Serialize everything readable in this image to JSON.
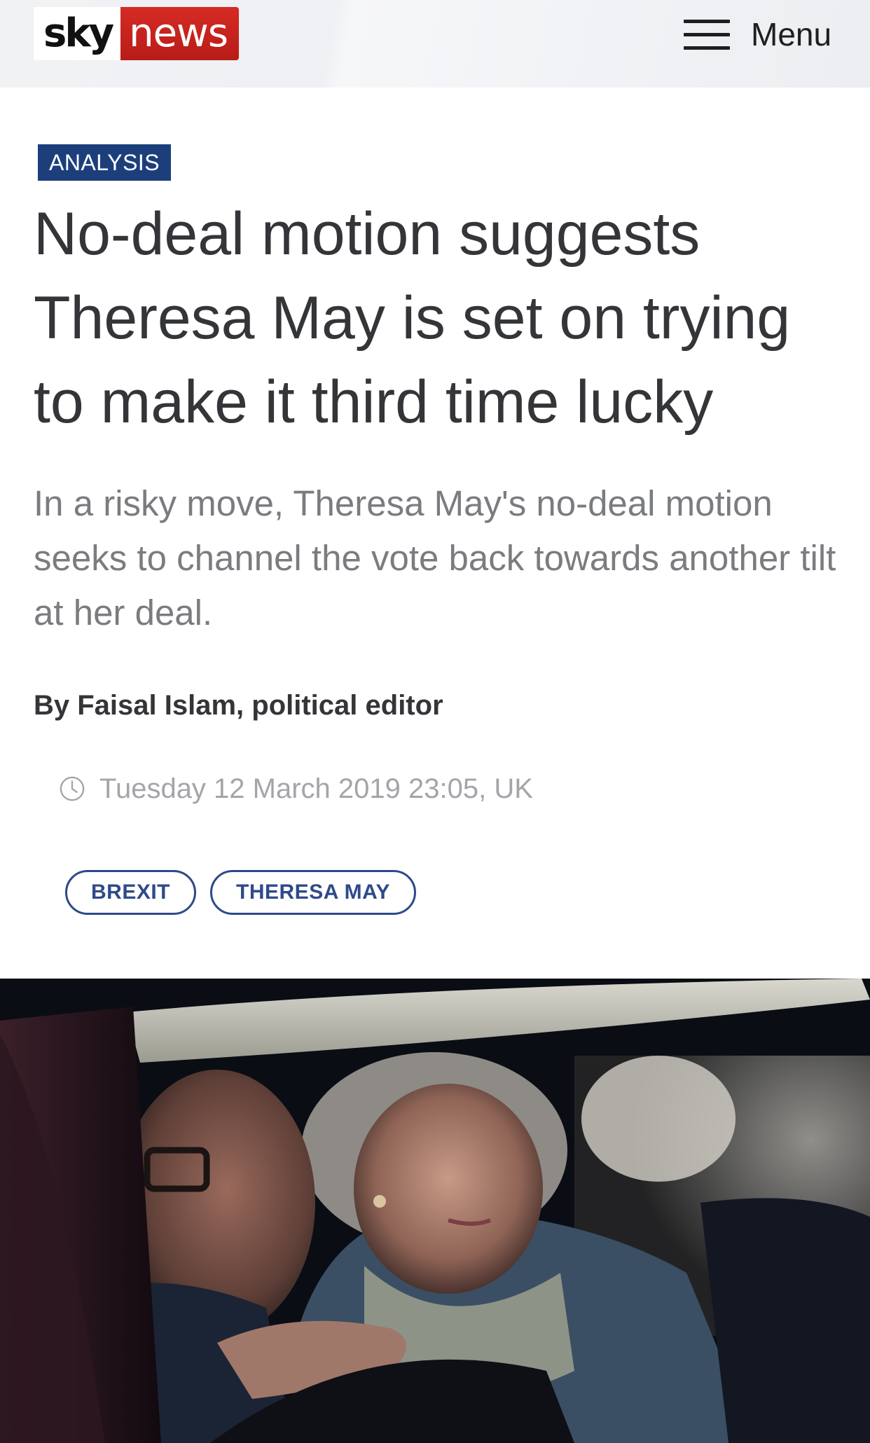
{
  "header": {
    "logo_sky": "sky",
    "logo_news": "news",
    "menu_label": "Menu",
    "menu_icon": "hamburger-icon",
    "brand_red": "#c8211d"
  },
  "article": {
    "category": "ANALYSIS",
    "category_color": "#1c3f7c",
    "headline": "No-deal motion suggests Theresa May is set on trying to make it third time lucky",
    "standfirst": "In a risky move, Theresa May's no-deal motion seeks to channel the vote back towards another tilt at her deal.",
    "byline": "By Faisal Islam, political editor",
    "timestamp": "Tuesday 12 March 2019 23:05, UK",
    "timestamp_icon": "clock-icon",
    "tags": [
      {
        "label": "BREXIT"
      },
      {
        "label": "THERESA MAY"
      }
    ],
    "tag_color": "#2f4a8a"
  },
  "hero_image": {
    "description_icon": "photo-image"
  }
}
